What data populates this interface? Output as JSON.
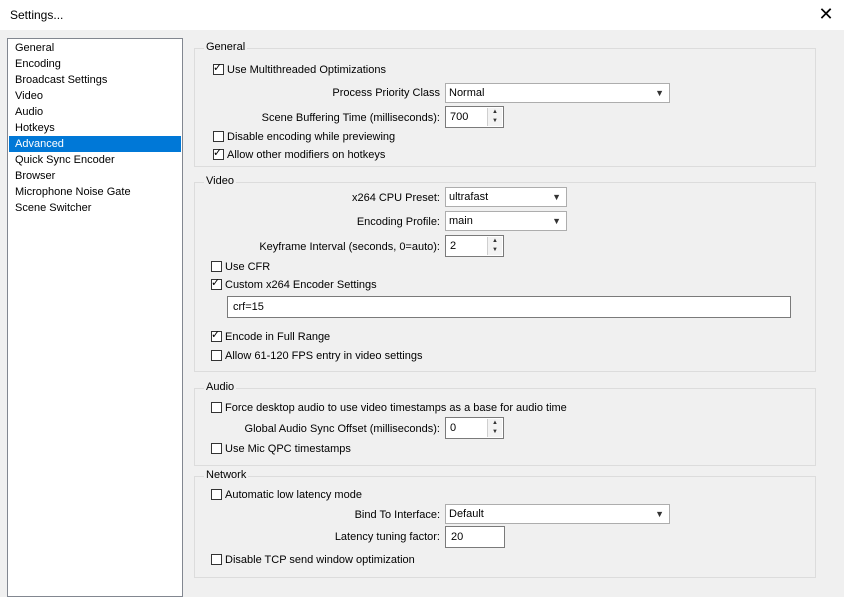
{
  "window": {
    "title": "Settings..."
  },
  "sidebar": {
    "items": [
      {
        "label": "General"
      },
      {
        "label": "Encoding"
      },
      {
        "label": "Broadcast Settings"
      },
      {
        "label": "Video"
      },
      {
        "label": "Audio"
      },
      {
        "label": "Hotkeys"
      },
      {
        "label": "Advanced",
        "selected": true
      },
      {
        "label": "Quick Sync Encoder"
      },
      {
        "label": "Browser"
      },
      {
        "label": "Microphone Noise Gate"
      },
      {
        "label": "Scene Switcher"
      }
    ]
  },
  "general": {
    "group_label": "General",
    "multithreaded": {
      "label": "Use Multithreaded Optimizations",
      "checked": true
    },
    "priority_label": "Process Priority Class",
    "priority_value": "Normal",
    "buffering_label": "Scene Buffering Time (milliseconds):",
    "buffering_value": "700",
    "disable_preview": {
      "label": "Disable encoding while previewing",
      "checked": false
    },
    "allow_modifiers": {
      "label": "Allow other modifiers on hotkeys",
      "checked": true
    }
  },
  "video": {
    "group_label": "Video",
    "preset_label": "x264 CPU Preset:",
    "preset_value": "ultrafast",
    "profile_label": "Encoding Profile:",
    "profile_value": "main",
    "keyframe_label": "Keyframe Interval (seconds, 0=auto):",
    "keyframe_value": "2",
    "use_cfr": {
      "label": "Use CFR",
      "checked": false
    },
    "custom_x264": {
      "label": "Custom x264 Encoder Settings",
      "checked": true
    },
    "custom_value": "crf=15",
    "full_range": {
      "label": "Encode in Full Range",
      "checked": true
    },
    "allow_fps": {
      "label": "Allow 61-120 FPS entry in video settings",
      "checked": false
    }
  },
  "audio": {
    "group_label": "Audio",
    "force_desktop": {
      "label": "Force desktop audio to use video timestamps as a base for audio time",
      "checked": false
    },
    "sync_label": "Global Audio Sync Offset (milliseconds):",
    "sync_value": "0",
    "mic_qpc": {
      "label": "Use Mic QPC timestamps",
      "checked": false
    }
  },
  "network": {
    "group_label": "Network",
    "low_latency": {
      "label": "Automatic low latency mode",
      "checked": false
    },
    "bind_label": "Bind To Interface:",
    "bind_value": "Default",
    "latency_label": "Latency tuning factor:",
    "latency_value": "20",
    "disable_tcp": {
      "label": "Disable TCP send window optimization",
      "checked": false
    }
  },
  "icons": {
    "close": "close-icon",
    "check": "checkmark-icon",
    "dropdown": "chevron-down-icon",
    "spin_up": "arrow-up-icon",
    "spin_down": "arrow-down-icon"
  },
  "colors": {
    "selection": "#0078d7",
    "background": "#f0f0f0"
  }
}
